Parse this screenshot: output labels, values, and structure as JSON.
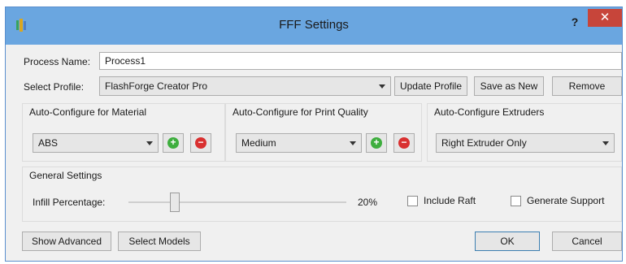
{
  "window": {
    "title": "FFF Settings",
    "help_label": "?",
    "close_label": "✕",
    "accent": "#6aa6e0"
  },
  "process": {
    "name_label": "Process Name:",
    "name_value": "Process1"
  },
  "profile": {
    "label": "Select Profile:",
    "selected": "FlashForge Creator Pro",
    "update_label": "Update Profile",
    "save_as_new_label": "Save as New",
    "remove_label": "Remove"
  },
  "material": {
    "title": "Auto-Configure for Material",
    "selected": "ABS"
  },
  "quality": {
    "title": "Auto-Configure for Print Quality",
    "selected": "Medium"
  },
  "extruders": {
    "title": "Auto-Configure Extruders",
    "selected": "Right Extruder Only"
  },
  "general": {
    "title": "General Settings",
    "infill_label": "Infill Percentage:",
    "infill_value_text": "20%",
    "infill_value": 20,
    "raft_label": "Include Raft",
    "raft_checked": false,
    "support_label": "Generate Support",
    "support_checked": false
  },
  "footer": {
    "show_advanced_label": "Show Advanced",
    "select_models_label": "Select Models",
    "ok_label": "OK",
    "cancel_label": "Cancel"
  },
  "icons": {
    "add": "plus-circle-icon",
    "remove": "minus-circle-icon",
    "green": "#3eae3e",
    "red": "#d93030"
  }
}
